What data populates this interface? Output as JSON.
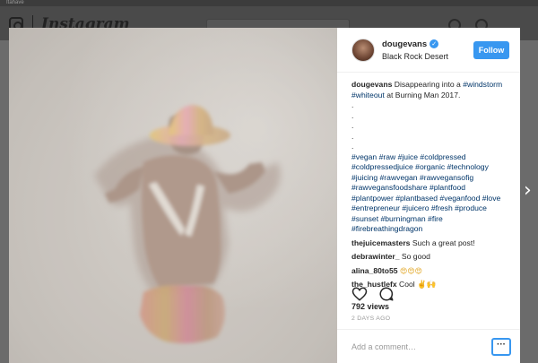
{
  "browser": {
    "tab_label": "Itahave"
  },
  "background": {
    "wordmark": "Instagram"
  },
  "post": {
    "username": "dougevans",
    "verified_icon": "verified-badge-icon",
    "location": "Black Rock Desert",
    "follow_label": "Follow",
    "caption": {
      "username": "dougevans",
      "text": "Disappearing into a",
      "tag1": "#windstorm",
      "tag2": "#whiteout",
      "text2": "at Burning Man 2017.",
      "dots": [
        ".",
        ".",
        ".",
        ".",
        "."
      ],
      "hashtags": [
        "#vegan #raw #juice #coldpressed",
        "#coldpressedjuice #organic #technology",
        "#juicing #rawvegan #rawvegansofig",
        "#rawvegansfoodshare #plantfood",
        "#plantpower #plantbased #veganfood #love",
        "#entrepreneur #juicero #fresh #produce",
        "#sunset #burningman #fire",
        "#firebreathingdragon"
      ]
    },
    "comments": [
      {
        "username": "thejuicemasters",
        "text": "Such a great post!"
      },
      {
        "username": "debrawinter_",
        "text": "So good"
      },
      {
        "username": "alina_80to55",
        "text": "😍😍😍"
      },
      {
        "username": "the_hustlefx",
        "text": "Cool ✌🙌"
      }
    ],
    "views": "792 views",
    "date": "2 DAYS AGO",
    "add_comment_placeholder": "Add a comment…",
    "more_label": "···"
  },
  "colors": {
    "accent": "#3897f0",
    "hashtag": "#003569",
    "text": "#262626",
    "muted": "#999999"
  }
}
